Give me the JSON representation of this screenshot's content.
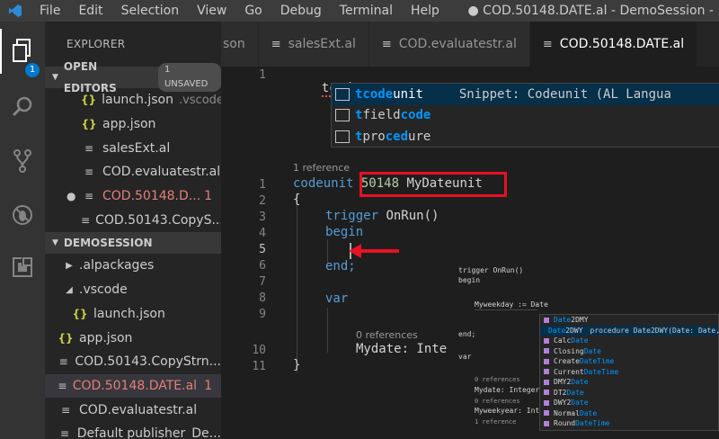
{
  "titlebar": {
    "menu": [
      "File",
      "Edit",
      "Selection",
      "View",
      "Go",
      "Debug",
      "Terminal",
      "Help"
    ],
    "window_title": "● COD.50148.DATE.al - DemoSession - "
  },
  "activity": {
    "badge": "1"
  },
  "sidebar": {
    "title": "EXPLORER",
    "open_editors": {
      "label": "OPEN EDITORS",
      "unsaved": "1 UNSAVED",
      "items": [
        {
          "icon": "{}",
          "name": "launch.json",
          "dir": ".vscode"
        },
        {
          "icon": "{}",
          "name": "app.json"
        },
        {
          "icon": "≡",
          "name": "salesExt.al"
        },
        {
          "icon": "≡",
          "name": "COD.evaluatestr.al"
        },
        {
          "icon": "≡",
          "name": "COD.50148.D...",
          "count": "1"
        },
        {
          "icon": "≡",
          "name": "COD.50143.CopyS..."
        }
      ]
    },
    "workspace": {
      "label": "DEMOSESSION",
      "items": [
        {
          "name": ".alpackages"
        },
        {
          "name": ".vscode"
        },
        {
          "name": "launch.json"
        },
        {
          "name": "app.json"
        },
        {
          "name": "COD.50143.CopyStrn..."
        },
        {
          "name": "COD.50148.DATE.al",
          "count": "1"
        },
        {
          "name": "COD.evaluatestr.al"
        },
        {
          "name": "Default publisher_De..."
        }
      ]
    }
  },
  "tabs": [
    {
      "label": "son"
    },
    {
      "label": "salesExt.al"
    },
    {
      "label": "COD.evaluatestr.al"
    },
    {
      "label": "COD.50148.DATE.al"
    }
  ],
  "editor": {
    "line1_num": "1",
    "line1_text": "tcode",
    "suggest": [
      {
        "pre": "tcode",
        "post": "unit",
        "detail": "Snippet: Codeunit (AL Langua"
      },
      {
        "pre": "t",
        "mid": "field",
        "hl2": "code",
        "post": ""
      },
      {
        "pre": "t",
        "mid": "pro",
        "hl2": "ced",
        "post": "ure"
      }
    ]
  },
  "shot": {
    "references": "1 reference",
    "line_numbers": [
      "1",
      "2",
      "3",
      "4",
      "5",
      "6",
      "7",
      "8",
      "9",
      "10",
      "11"
    ],
    "codeunit_kw": "codeunit",
    "codeunit_id": "50148",
    "codeunit_name": "MyDateunit",
    "brace_open": "{",
    "trigger_kw": "trigger",
    "trigger_name": "OnRun()",
    "begin_kw": "begin",
    "end_kw": "end;",
    "var_kw": "var",
    "zero_refs": "0 references",
    "mydate": "Mydate: Inte",
    "brace_close": "}"
  },
  "inset": {
    "lines": [
      "trigger OnRun()",
      "begin",
      "Myweekday := Date",
      "end;",
      "var"
    ],
    "refs": [
      "0 references",
      "0 references",
      "1 reference"
    ],
    "var1": "Mydate: Integer;",
    "var2": "Myweekyear: Integ",
    "suggest": [
      {
        "pre": "Date",
        "post": "2DMY",
        "detail": ""
      },
      {
        "pre": "Date",
        "post": "2DWY",
        "detail": "procedure Date2DWY(Date: Date,"
      },
      {
        "pre": "Calc",
        "post": "Date",
        "detail": ""
      },
      {
        "pre": "Closing",
        "post": "Date",
        "detail": ""
      },
      {
        "pre": "Create",
        "post": "DateTime",
        "detail": ""
      },
      {
        "pre": "Current",
        "post": "DateTime",
        "detail": ""
      },
      {
        "pre": "DMY2",
        "post": "Date",
        "detail": ""
      },
      {
        "pre": "DT2",
        "post": "Date",
        "detail": ""
      },
      {
        "pre": "DWY2",
        "post": "Date",
        "detail": ""
      },
      {
        "pre": "Normal",
        "post": "Date",
        "detail": ""
      },
      {
        "pre": "Round",
        "post": "DateTime",
        "detail": ""
      }
    ]
  }
}
